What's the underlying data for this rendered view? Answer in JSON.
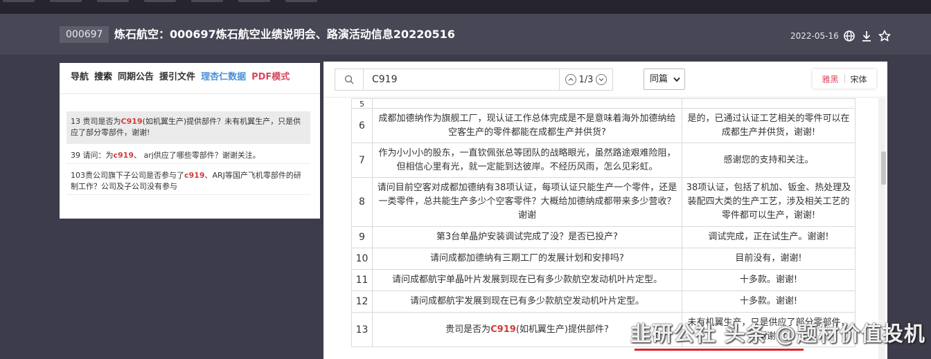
{
  "header": {
    "code": "000697",
    "title": "炼石航空：000697炼石航空业绩说明会、路演活动信息20220516",
    "date": "2022-05-16",
    "icons": [
      "globe-icon",
      "download-icon",
      "star-icon"
    ]
  },
  "left_panel": {
    "tabs": [
      "导航",
      "搜索",
      "同期公告",
      "援引文件",
      "理杏仁数据",
      "PDF模式"
    ],
    "results": [
      {
        "num": "13",
        "pre": "贵司是否为",
        "hl": "C919",
        "post": "(如机翼生产)提供部件？未有机翼生产，只是供应了部分零部件，谢谢!"
      },
      {
        "num": "39",
        "pre": "请问：为",
        "hl": "c919",
        "post": "、 arj供应了哪些零部件？谢谢关注。"
      },
      {
        "num": "103",
        "pre": "贵公司旗下子公司是否参与了",
        "hl": "c919",
        "post": "、ARJ等国产飞机零部件的研制工作？公司及子公司没有参与"
      }
    ]
  },
  "toolbar": {
    "search_value": "C919",
    "match_count": "1/3",
    "scope_select": "同篇",
    "font_options": [
      "雅黑",
      "宋体"
    ]
  },
  "table": {
    "partial_row_num": "5",
    "rows": [
      {
        "num": "6",
        "q": "成都加德纳作为旗舰工厂，现认证工作总体完成是不是意味着海外加德纳给空客生产的零件都能在成都生产并供货?",
        "a": "是的，已通过认证工艺相关的零件可以在成都生产并供货，谢谢!"
      },
      {
        "num": "7",
        "q": "作为小小小的股东，一直钦佩张总等团队的战略眼光，虽然路途艰难险阻，但相信心里有光，就一定能到达彼岸。不经历风雨，怎么见彩虹。",
        "a": "感谢您的支持和关注。"
      },
      {
        "num": "8",
        "q": "请问目前空客对成都加德纳有38项认证，每项认证只能生产一个零件，还是一类零件，总共能生产多少个空客零件？大概给加德纳成都带来多少营收？谢谢",
        "a": "38项认证，包括了机加、钣金、热处理及装配四大类的生产工艺，涉及相关工艺的零件都可以生产，谢谢!"
      },
      {
        "num": "9",
        "q": "第3台单晶炉安装调试完成了没？是否已投产?",
        "a": "调试完成，正在试生产。谢谢!"
      },
      {
        "num": "10",
        "q": "请问成都加德纳有三期工厂的发展计划和安排吗?",
        "a": "目前没有，谢谢!"
      },
      {
        "num": "11",
        "q": "请问成都航宇单晶叶片发展到现在已有多少款航空发动机叶片定型。",
        "a": "十多款。谢谢!"
      },
      {
        "num": "12",
        "q": "请问成都航宇发展到现在已有多少款航空发动机叶片定型。",
        "a": "十多款。谢谢!"
      },
      {
        "num": "13",
        "q_pre": "贵司是否为",
        "q_hl": "C919",
        "q_post": "(如机翼生产)提供部件?",
        "a": "未有机翼生产，只是供应了部分零部件，谢谢!"
      }
    ]
  },
  "watermark": "韭研公社 头条 @题材价值投机"
}
